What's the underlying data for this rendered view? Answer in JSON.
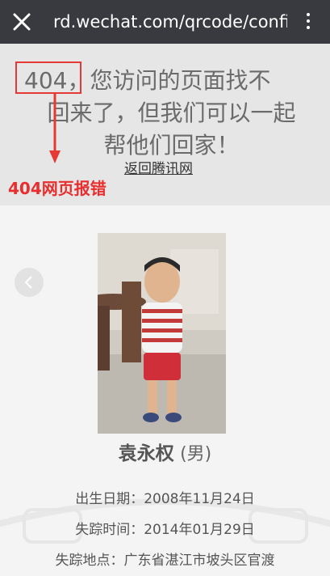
{
  "browser": {
    "url": "rd.wechat.com/qrcode/confir…",
    "close_icon": "close-icon",
    "menu_icon": "more-vertical-icon"
  },
  "error": {
    "code": "404",
    "line1_rest": "，您访问的页面找不",
    "line2": "回来了，但我们可以一起",
    "line3": "帮他们回家！",
    "back_link": "返回腾讯网",
    "annotation": "404网页报错",
    "accent": "#e53935"
  },
  "missing_person": {
    "name": "袁永权",
    "gender": "(男)",
    "birth_label": "出生日期：",
    "birth_value": "2008年11月24日",
    "missing_time_label": "失踪时间：",
    "missing_time_value": "2014年01月29日",
    "missing_place_label": "失踪地点：",
    "missing_place_value": "广东省湛江市坡头区官渡"
  }
}
